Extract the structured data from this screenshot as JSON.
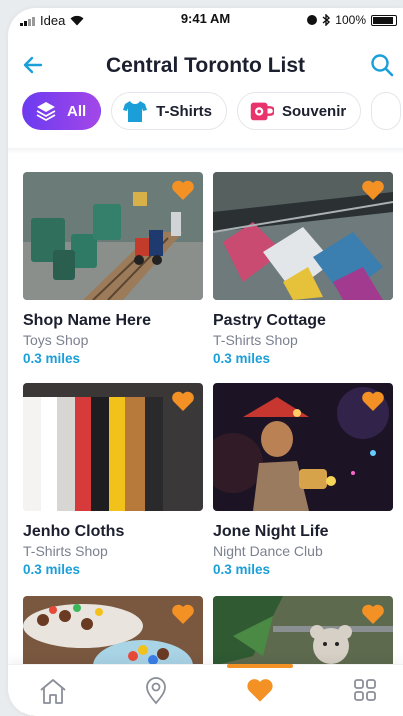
{
  "status": {
    "carrier": "Idea",
    "time": "9:41 AM",
    "battery": "100%"
  },
  "header": {
    "title": "Central Toronto List"
  },
  "chips": [
    {
      "label": "All",
      "icon": "layers-icon",
      "active": true
    },
    {
      "label": "T-Shirts",
      "icon": "tshirt-icon",
      "active": false
    },
    {
      "label": "Souvenir",
      "icon": "mug-icon",
      "active": false
    }
  ],
  "cards": [
    {
      "name": "Shop Name Here",
      "type": "Toys Shop",
      "distance": "0.3 miles",
      "image": "toy-train-image"
    },
    {
      "name": "Pastry Cottage",
      "type": "T-Shirts Shop",
      "distance": "0.3 miles",
      "image": "clothes-rack-image"
    },
    {
      "name": "Jenho Cloths",
      "type": "T-Shirts Shop",
      "distance": "0.3 miles",
      "image": "shirts-hanger-image"
    },
    {
      "name": "Jone Night Life",
      "type": "Night Dance Club",
      "distance": "0.3 miles",
      "image": "night-party-image"
    },
    {
      "name": "",
      "type": "",
      "distance": "",
      "image": "candy-image"
    },
    {
      "name": "",
      "type": "",
      "distance": "",
      "image": "teddy-bear-image"
    }
  ],
  "nav": [
    {
      "icon": "home-icon",
      "active": false
    },
    {
      "icon": "location-icon",
      "active": false
    },
    {
      "icon": "heart-icon",
      "active": true
    },
    {
      "icon": "grid-icon",
      "active": false
    }
  ],
  "colors": {
    "accent": "#1a9fd9",
    "favorite": "#f39124",
    "chip_gradient_start": "#6c3bf0",
    "chip_gradient_end": "#a347e8"
  }
}
